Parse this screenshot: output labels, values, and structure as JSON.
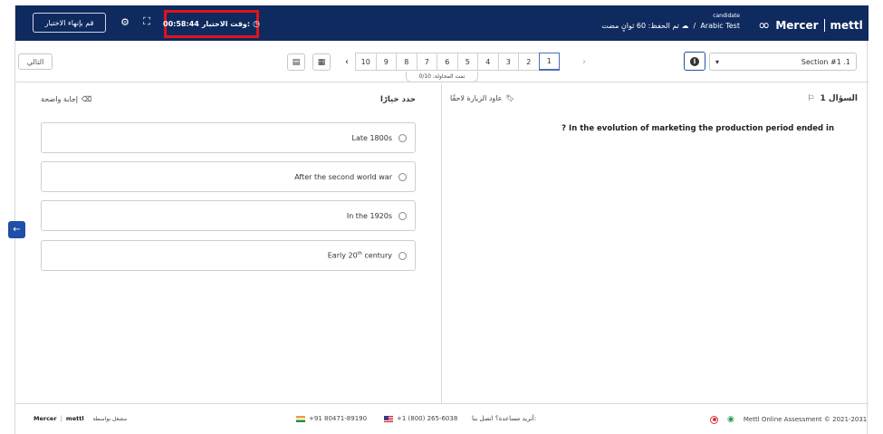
{
  "header": {
    "end_test_label": "قم بإنهاء الاختبار",
    "timer_label": "وقت الاختبار:",
    "timer_value": "00:58:44",
    "save_status": "تم الحفظ: 60 ثوانٍ مضت",
    "candidate_label": "candidate",
    "test_name": "Arabic Test",
    "brand_mercer": "Mercer",
    "brand_mettl": "mettl"
  },
  "toolbar": {
    "next_label": "التالي",
    "pages": [
      "10",
      "9",
      "8",
      "7",
      "6",
      "5",
      "4",
      "3",
      "2",
      "1"
    ],
    "active_page": "1",
    "attempt_status": "تمت المحاولة: 0/10",
    "section_label": "Section #1 .1"
  },
  "question": {
    "title": "السؤال 1",
    "revisit_label": "عاود الزيارة لاحقًا",
    "text": "? In the evolution of marketing the production period ended in"
  },
  "answers": {
    "prompt": "حدد خيارًا",
    "clear_label": "إجابة واضحة",
    "options": [
      {
        "text": "Late 1800s"
      },
      {
        "text": "After the second world war"
      },
      {
        "text": "In the 1920s"
      },
      {
        "pre": "Early 20",
        "sup": "th",
        "post": " century"
      }
    ]
  },
  "footer": {
    "powered_by": "مشغل بواسطة",
    "brand_mercer": "Mercer",
    "brand_mettl": "mettl",
    "india_phone": "+91 80471-89190",
    "us_phone": "+1 (800) 265-6038",
    "help_text": "أتريد مساعدة؟ اتصل بنا:",
    "copyright": "Mettl Online Assessment © 2021-2031"
  }
}
